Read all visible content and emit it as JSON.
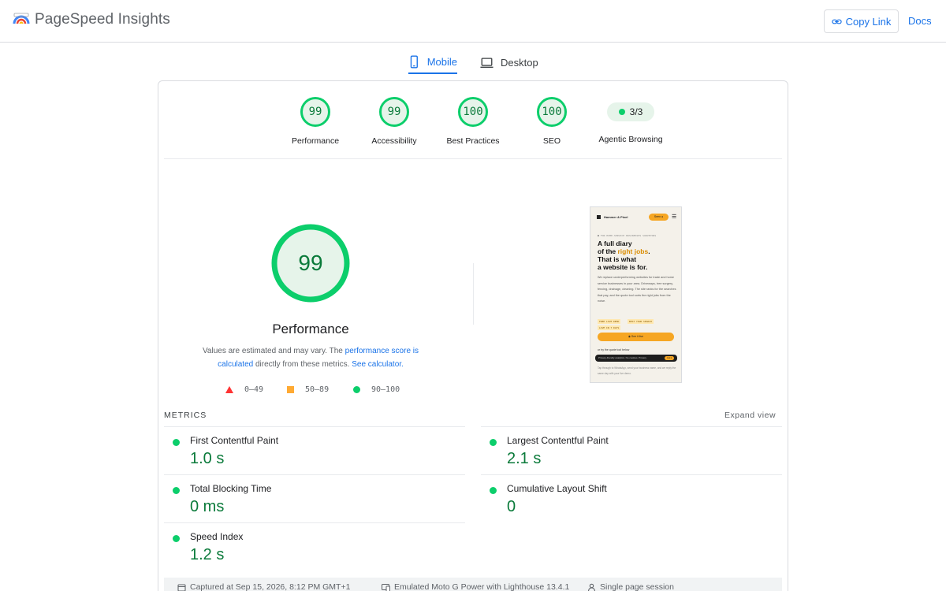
{
  "header": {
    "app_title": "PageSpeed Insights",
    "copy_link_label": "Copy Link",
    "docs_label": "Docs"
  },
  "tabs": [
    {
      "label": "Mobile",
      "active": true
    },
    {
      "label": "Desktop",
      "active": false
    }
  ],
  "scores": [
    {
      "label": "Performance",
      "value": "99"
    },
    {
      "label": "Accessibility",
      "value": "99"
    },
    {
      "label": "Best Practices",
      "value": "100"
    },
    {
      "label": "SEO",
      "value": "100"
    }
  ],
  "agentic": {
    "label": "Agentic Browsing",
    "value": "3/3"
  },
  "main_score": {
    "value": "99",
    "title": "Performance",
    "disclaimer_prefix": "Values are estimated and may vary. The ",
    "disclaimer_link1": "performance score is calculated",
    "disclaimer_middle": " directly from these metrics. ",
    "disclaimer_link2": "See calculator."
  },
  "legend": [
    {
      "shape": "triangle",
      "label": "0–49",
      "color": "#ff3333"
    },
    {
      "shape": "square",
      "label": "50–89",
      "color": "#ffaa33"
    },
    {
      "shape": "circle",
      "label": "90–100",
      "color": "#0cce6b"
    }
  ],
  "screenshot": {
    "brand": "Hammer & Pixel",
    "pill": "Seen ●",
    "eyebrow": "■ FOR HOME-SERVICE BUSINESSES SURVEYORS",
    "h1_line1": "A full diary",
    "h1_line2a": "of the ",
    "h1_accent": "right jobs",
    "h1_line2b": ".",
    "h1_line3": "That is what",
    "h1_line4": "a website is for.",
    "body": "We replace underperforming websites for trade and home service businesses in your area. Driveways, tree surgery, fencing, drainage, cleaning. The site ranks for the searches that pay, and the quote tool sorts the right jobs from the noise.",
    "tag1": "FREE LIVE DEMO",
    "tag2": "BEST YOUR SEARCH",
    "tag3": "LIVE IN 7 DAYS",
    "cta": "◉ See it live",
    "link": "or try the quote tool below",
    "bar_text": "Privacy-friendly analytics. No cookies. Privacy",
    "bar_btn": "Got it",
    "foot": "Tap through to WhatsApp, send your business name, and we reply the same day with your live demo."
  },
  "metrics": {
    "heading": "METRICS",
    "expand_label": "Expand view",
    "items": [
      {
        "name": "First Contentful Paint",
        "value": "1.0 s"
      },
      {
        "name": "Largest Contentful Paint",
        "value": "2.1 s"
      },
      {
        "name": "Total Blocking Time",
        "value": "0 ms"
      },
      {
        "name": "Cumulative Layout Shift",
        "value": "0"
      },
      {
        "name": "Speed Index",
        "value": "1.2 s"
      }
    ]
  },
  "footer": {
    "captured": "Captured at Sep 15, 2026, 8:12 PM GMT+1",
    "device": "Emulated Moto G Power with Lighthouse 13.4.1",
    "session": "Single page session"
  },
  "colors": {
    "pass": "#0cce6b",
    "pass_text": "#0a7a3a",
    "accent": "#1a73e8"
  }
}
